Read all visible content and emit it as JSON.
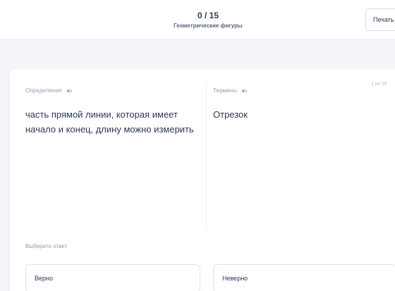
{
  "header": {
    "progress": "0 / 15",
    "title": "Геометрические фигуры",
    "print_label": "Печать"
  },
  "card": {
    "definition_label": "Определения",
    "term_label": "Термины",
    "counter": "1 из 15",
    "definition": "часть прямой линии, которая имеет начало и конец, длину можно измерить",
    "term": "Отрезок",
    "choose_label": "Выберите ответ",
    "answers": [
      "Верно",
      "Неверно"
    ]
  },
  "icons": {
    "speaker": "speaker-icon"
  }
}
